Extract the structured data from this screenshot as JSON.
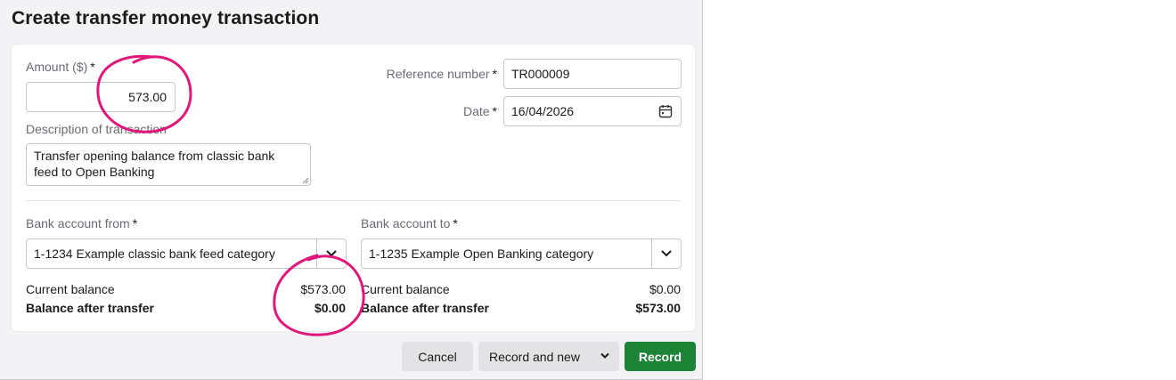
{
  "dialog": {
    "title": "Create transfer money transaction"
  },
  "amount": {
    "label": "Amount ($)",
    "required_mark": "*",
    "value": "573.00"
  },
  "description": {
    "label": "Description of transaction",
    "line1": "Transfer opening balance from classic bank",
    "line2": "feed to Open Banking"
  },
  "reference": {
    "label": "Reference number",
    "required_mark": "*",
    "value": "TR000009"
  },
  "date": {
    "label": "Date",
    "required_mark": "*",
    "value": "16/04/2026",
    "icon": "calendar-icon"
  },
  "from": {
    "label": "Bank account from",
    "required_mark": "*",
    "selected": "1-1234  Example classic bank feed category",
    "current_label": "Current balance",
    "current_value": "$573.00",
    "after_label": "Balance after transfer",
    "after_value": "$0.00"
  },
  "to": {
    "label": "Bank account to",
    "required_mark": "*",
    "selected": "1-1235  Example Open Banking category",
    "current_label": "Current balance",
    "current_value": "$0.00",
    "after_label": "Balance after transfer",
    "after_value": "$573.00"
  },
  "buttons": {
    "cancel": "Cancel",
    "record_and_new": "Record and new",
    "record": "Record"
  },
  "colors": {
    "primary": "#1d8437",
    "annotation": "#e0187c"
  }
}
